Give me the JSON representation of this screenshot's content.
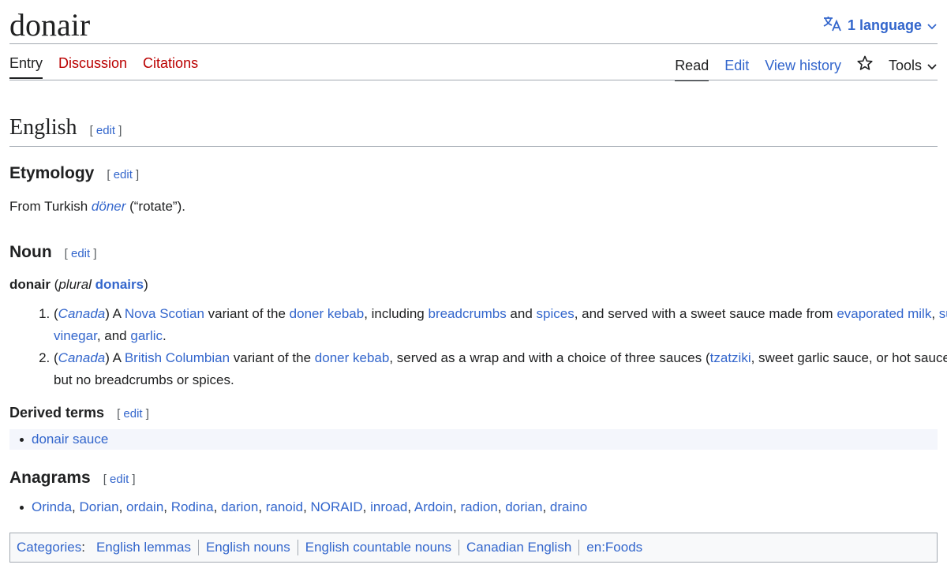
{
  "title": "donair",
  "language_button": "1 language",
  "tabs_left": [
    "Entry",
    "Discussion",
    "Citations"
  ],
  "tabs_right": [
    "Read",
    "Edit",
    "View history"
  ],
  "tools_label": "Tools",
  "edit_label": "edit",
  "sections": {
    "english": "English",
    "etymology": "Etymology",
    "noun": "Noun",
    "derived_terms": "Derived terms",
    "anagrams": "Anagrams"
  },
  "etymology": {
    "prefix": "From Turkish ",
    "word": "döner",
    "suffix": " (“rotate”)."
  },
  "headword": {
    "word": "donair",
    "plural_label": "plural",
    "plural": "donairs"
  },
  "senses": [
    {
      "label": "Canada",
      "parts": [
        {
          "t": ") A "
        },
        {
          "l": "Nova Scotian"
        },
        {
          "t": " variant of the "
        },
        {
          "l": "doner kebab"
        },
        {
          "t": ", including "
        },
        {
          "l": "breadcrumbs"
        },
        {
          "t": " and "
        },
        {
          "l": "spices"
        },
        {
          "t": ", and served with a sweet sauce made from "
        },
        {
          "l": "evaporated milk"
        },
        {
          "t": ", "
        },
        {
          "l": "sugar"
        },
        {
          "t": ", "
        },
        {
          "l": "vinegar"
        },
        {
          "t": ", and "
        },
        {
          "l": "garlic"
        },
        {
          "t": "."
        }
      ]
    },
    {
      "label": "Canada",
      "parts": [
        {
          "t": ") A "
        },
        {
          "l": "British Columbian"
        },
        {
          "t": " variant of the "
        },
        {
          "l": "doner kebab"
        },
        {
          "t": ", served as a wrap and with a choice of three sauces ("
        },
        {
          "l": "tzatziki"
        },
        {
          "t": ", sweet garlic sauce, or hot sauce), but no breadcrumbs or spices."
        }
      ]
    }
  ],
  "derived_terms": [
    "donair sauce"
  ],
  "anagrams": [
    "Orinda",
    "Dorian",
    "ordain",
    "Rodina",
    "darion",
    "ranoid",
    "NORAID",
    "inroad",
    "Ardoin",
    "radion",
    "dorian",
    "draino"
  ],
  "categories_label": "Categories",
  "categories": [
    "English lemmas",
    "English nouns",
    "English countable nouns",
    "Canadian English",
    "en:Foods"
  ],
  "colors": {
    "link": "#3366cc",
    "red_link": "#ba0000",
    "text": "#202122",
    "rule": "#a2a9b1"
  }
}
